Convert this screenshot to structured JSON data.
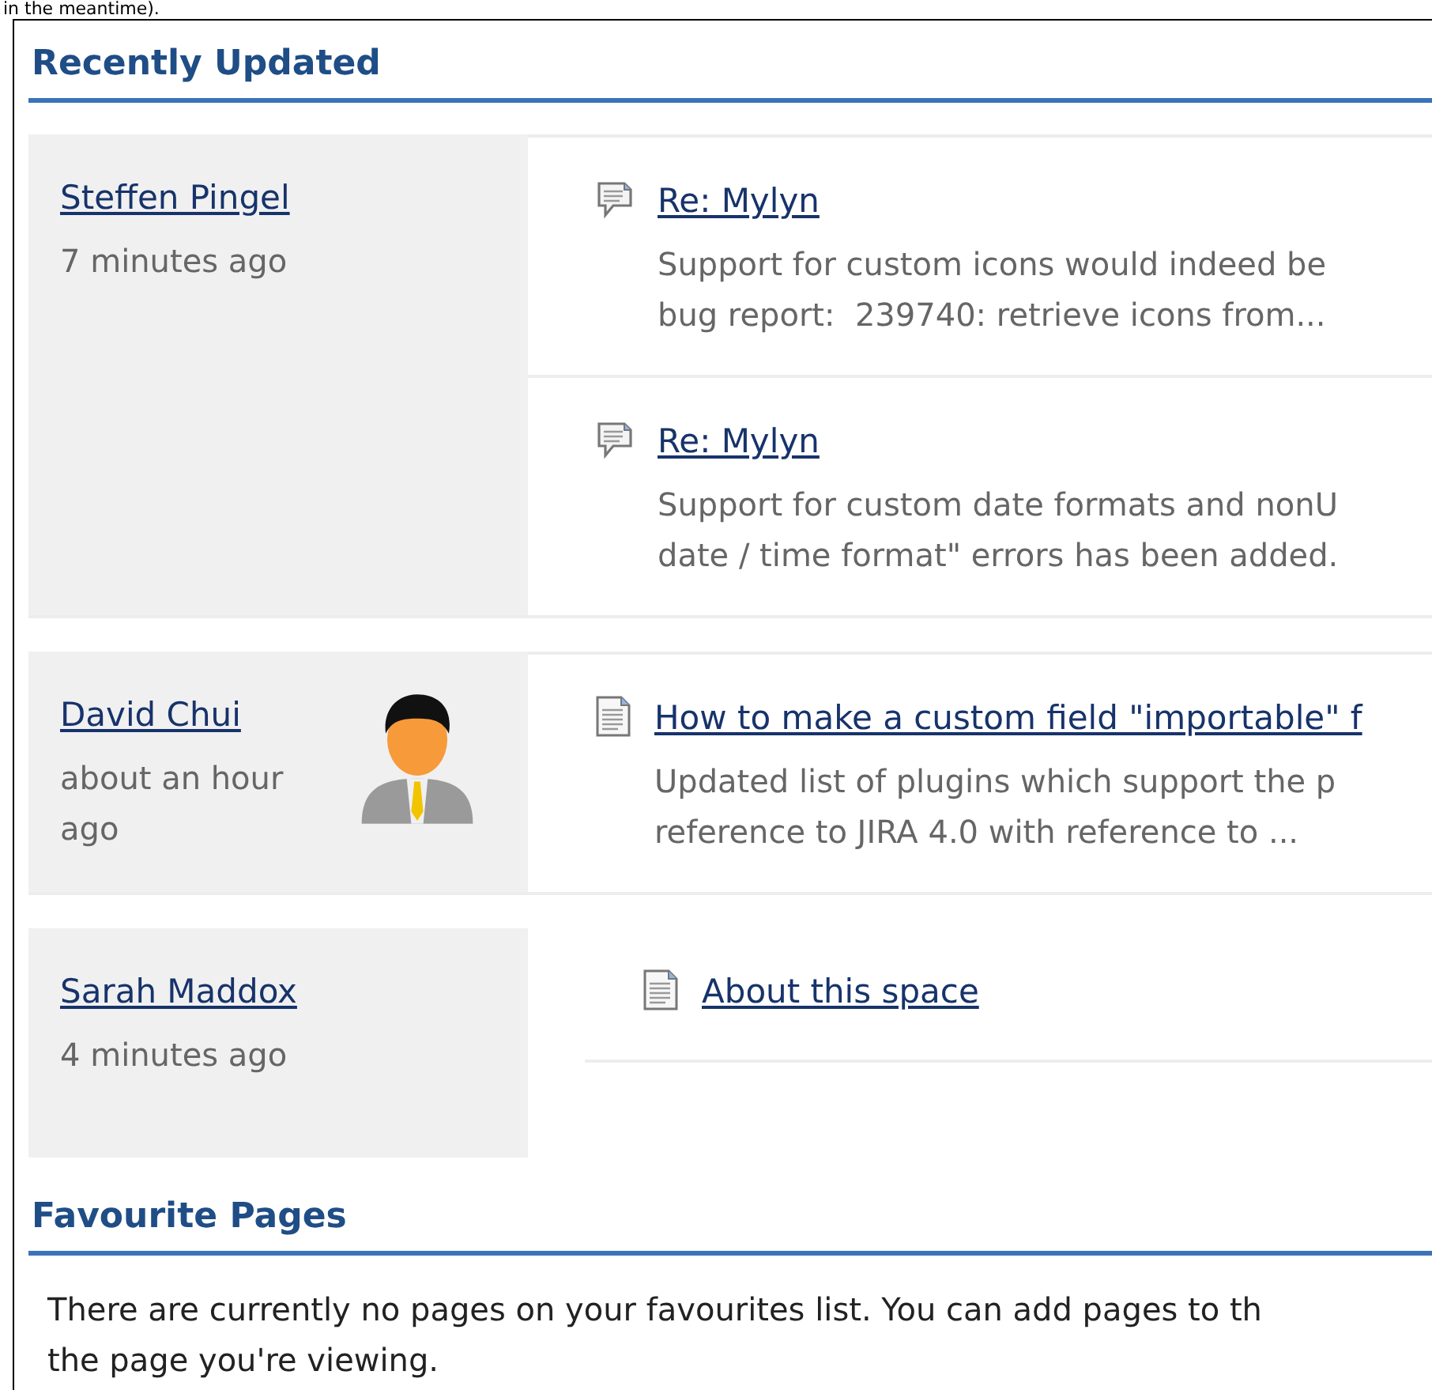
{
  "top_text": "in the meantime).",
  "recent": {
    "title": "Recently Updated",
    "groups": [
      {
        "author": "Steffen Pingel",
        "time": "7 minutes ago",
        "avatar": false,
        "items": [
          {
            "kind": "comment",
            "title": "Re: Mylyn",
            "lines": [
              "Support for custom icons would indeed be",
              "bug report:  239740: retrieve icons from..."
            ]
          },
          {
            "kind": "comment",
            "title": "Re: Mylyn",
            "lines": [
              "Support for custom date formats and nonU",
              "date / time format\" errors has been added."
            ]
          }
        ]
      },
      {
        "author": "David Chui",
        "time": "about an hour ago",
        "avatar": true,
        "items": [
          {
            "kind": "page",
            "title": "How to make a custom field \"importable\" f",
            "lines": [
              "Updated list of plugins which support the p",
              "reference to JIRA 4.0 with reference to ..."
            ]
          }
        ]
      },
      {
        "author": "Sarah Maddox",
        "time": "4 minutes ago",
        "avatar": false,
        "items": [
          {
            "kind": "page",
            "title": "About this space"
          }
        ]
      }
    ]
  },
  "favourites": {
    "title": "Favourite Pages",
    "text": "There are currently no pages on your favourites list. You can add pages to th",
    "text_2": "the page you're viewing."
  }
}
